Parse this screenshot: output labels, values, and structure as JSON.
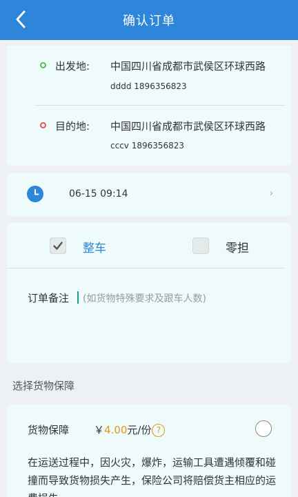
{
  "header": {
    "title": "确认订单",
    "back_icon": "chevron-left-icon"
  },
  "origin": {
    "label": "出发地:",
    "address": "中国四川省成都市武侯区环球西路",
    "contact": "dddd 1896356823",
    "dot_color": "#5cb85c"
  },
  "destination": {
    "label": "目的地:",
    "address": "中国四川省成都市武侯区环球西路",
    "contact": "cccv 1896356823",
    "dot_color": "#e25555"
  },
  "time": {
    "icon": "clock-icon",
    "value": "06-15 09:14",
    "chevron": "›"
  },
  "shipment_type": {
    "options": [
      {
        "label": "整车",
        "checked": true,
        "color": "#2d86d9"
      },
      {
        "label": "零担",
        "checked": false,
        "color": "#333333"
      }
    ]
  },
  "remark": {
    "label": "订单备注",
    "placeholder": "(如货物特殊要求及跟车人数)"
  },
  "insurance_section": {
    "title": "选择货物保障"
  },
  "insurance": {
    "label": "货物保障",
    "currency": "￥",
    "amount": "4.00",
    "unit": "元/份",
    "help": "?",
    "selected": false,
    "description": "在运送过程中，因火灾，爆炸，运输工具遭遇倾覆和碰撞而导致货物损失产生，保险公司将赔偿货主相应的运费损失。"
  },
  "colors": {
    "primary": "#2d86d9",
    "accent": "#e09a17",
    "card_bg": "#effafa",
    "page_bg": "#eef1f4"
  }
}
